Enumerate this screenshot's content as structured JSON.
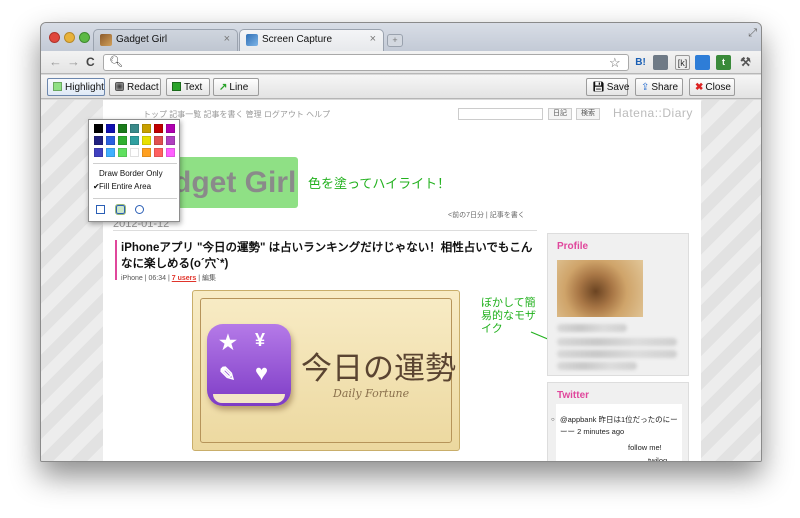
{
  "tabs": [
    {
      "label": "Gadget Girl",
      "close": "×"
    },
    {
      "label": "Screen Capture",
      "close": "×"
    }
  ],
  "toolbar": {
    "back": "←",
    "forward": "→",
    "reload": "C",
    "bookmark_star": "☆",
    "ext_b": "B!",
    "ext_k": "[k]",
    "ext_t": "t",
    "wrench": "🔧"
  },
  "capture": {
    "highlight": "Highlight",
    "redact": "Redact",
    "text": "Text",
    "line": "Line",
    "save": "Save",
    "share": "Share",
    "close": "Close"
  },
  "palette": {
    "colors": [
      "#000000",
      "#1010b0",
      "#1a7a1a",
      "#3a8a8a",
      "#c8a000",
      "#c00000",
      "#b000b0",
      "#202080",
      "#2a60e0",
      "#30b030",
      "#30a0a0",
      "#e8e000",
      "#e05050",
      "#b040c0",
      "#4040c0",
      "#40b0ff",
      "#60e060",
      "#ffffff",
      "#ffa020",
      "#ff6060",
      "#ff60ff"
    ],
    "options": [
      "Draw Border Only",
      "Fill Entire Area"
    ],
    "checked": "✔"
  },
  "page": {
    "topnav": "トップ  記事一覧  記事を書く  管理  ログアウト  ヘルプ",
    "diary_btn": "日記",
    "search_btn": "検索",
    "hatena": "Hatena::Diary",
    "blog_title": "Gadget Girl",
    "note_highlight": "色を塗ってハイライト！",
    "date": "2012-01-12",
    "prev_link": "<前の7日分  | 記事を書く",
    "entry_title": "iPhoneアプリ \"今日の運勢\" は占いランキングだけじゃない！相性占いでもこんなに楽しめる(o´穴`*)",
    "entry_meta_prefix": "iPhone | 06:34 | ",
    "entry_users": "7 users",
    "entry_meta_suffix": " | 編集",
    "fortune_title": "今日の運勢",
    "fortune_sub": "Daily Fortune",
    "note_blur": "ぼかして簡易的なモザイク",
    "profile_head": "Profile",
    "twitter_head": "Twitter",
    "tweet": "@appbank 昨日は1位だったのにーーー 2 minutes ago",
    "follow": "follow me!",
    "twilog": "twilog"
  },
  "colors": {
    "highlight_green": "#8fe085",
    "note_green": "#22b11e",
    "accent_pink": "#e0479c"
  }
}
